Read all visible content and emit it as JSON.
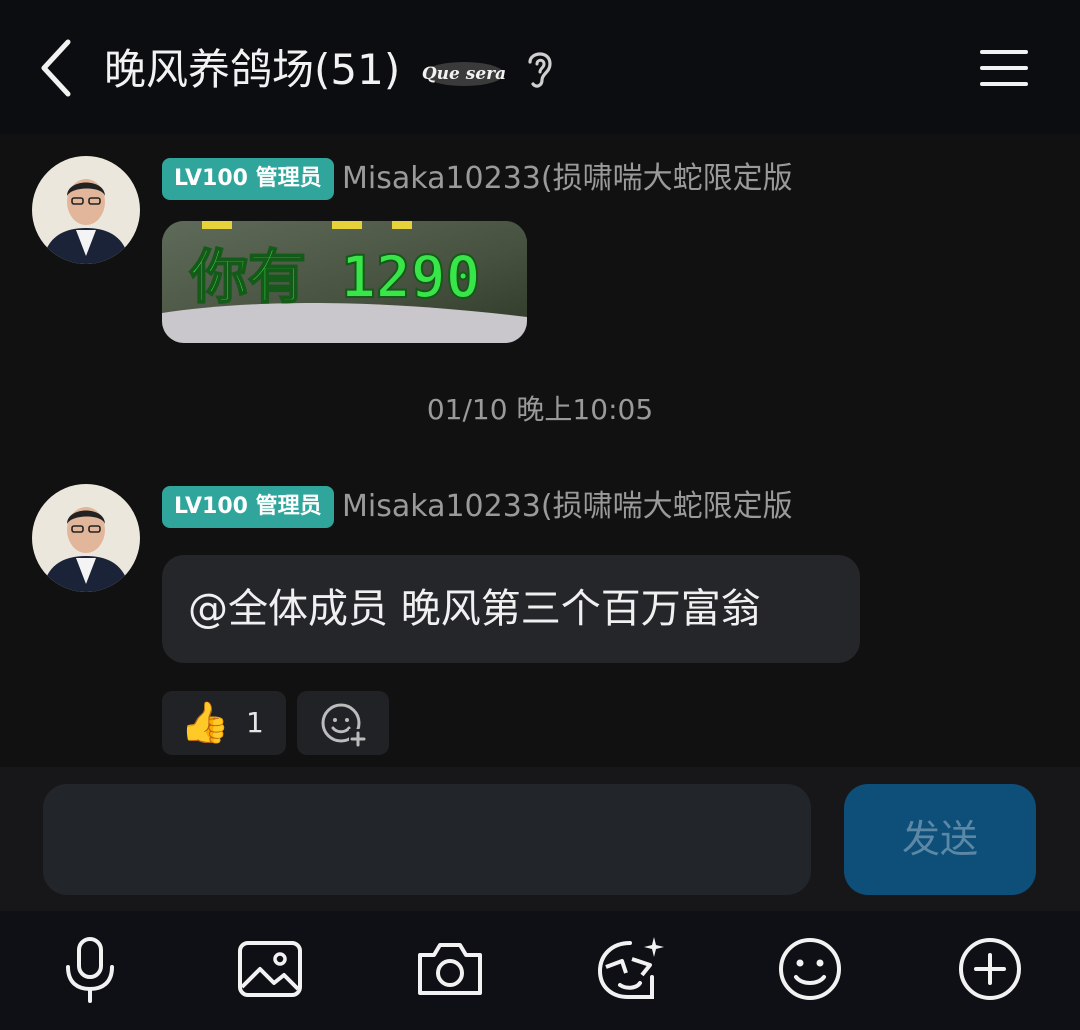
{
  "header": {
    "title": "晚风养鸽场(51)",
    "logo_text": "Que sera"
  },
  "messages": [
    {
      "level_badge": "LV100 管理员",
      "sender": "Misaka10233(损啸喘大蛇限定版",
      "image_text": "你有 1290"
    },
    {
      "level_badge": "LV100 管理员",
      "sender": "Misaka10233(损啸喘大蛇限定版",
      "text": "@全体成员 晚风第三个百万富翁"
    }
  ],
  "separator_time": "01/10 晚上10:05",
  "reaction": {
    "emoji": "👍",
    "count": "1"
  },
  "input": {
    "placeholder": "",
    "send_label": "发送"
  },
  "toolbar": [
    "microphone-icon",
    "image-icon",
    "camera-icon",
    "sticker-icon",
    "emoji-icon",
    "plus-icon"
  ],
  "colors": {
    "background": "#111111",
    "header": "#0c0d10",
    "badge": "#2fa59b",
    "send_button": "#0d4f78",
    "bubble": "#24262a"
  }
}
